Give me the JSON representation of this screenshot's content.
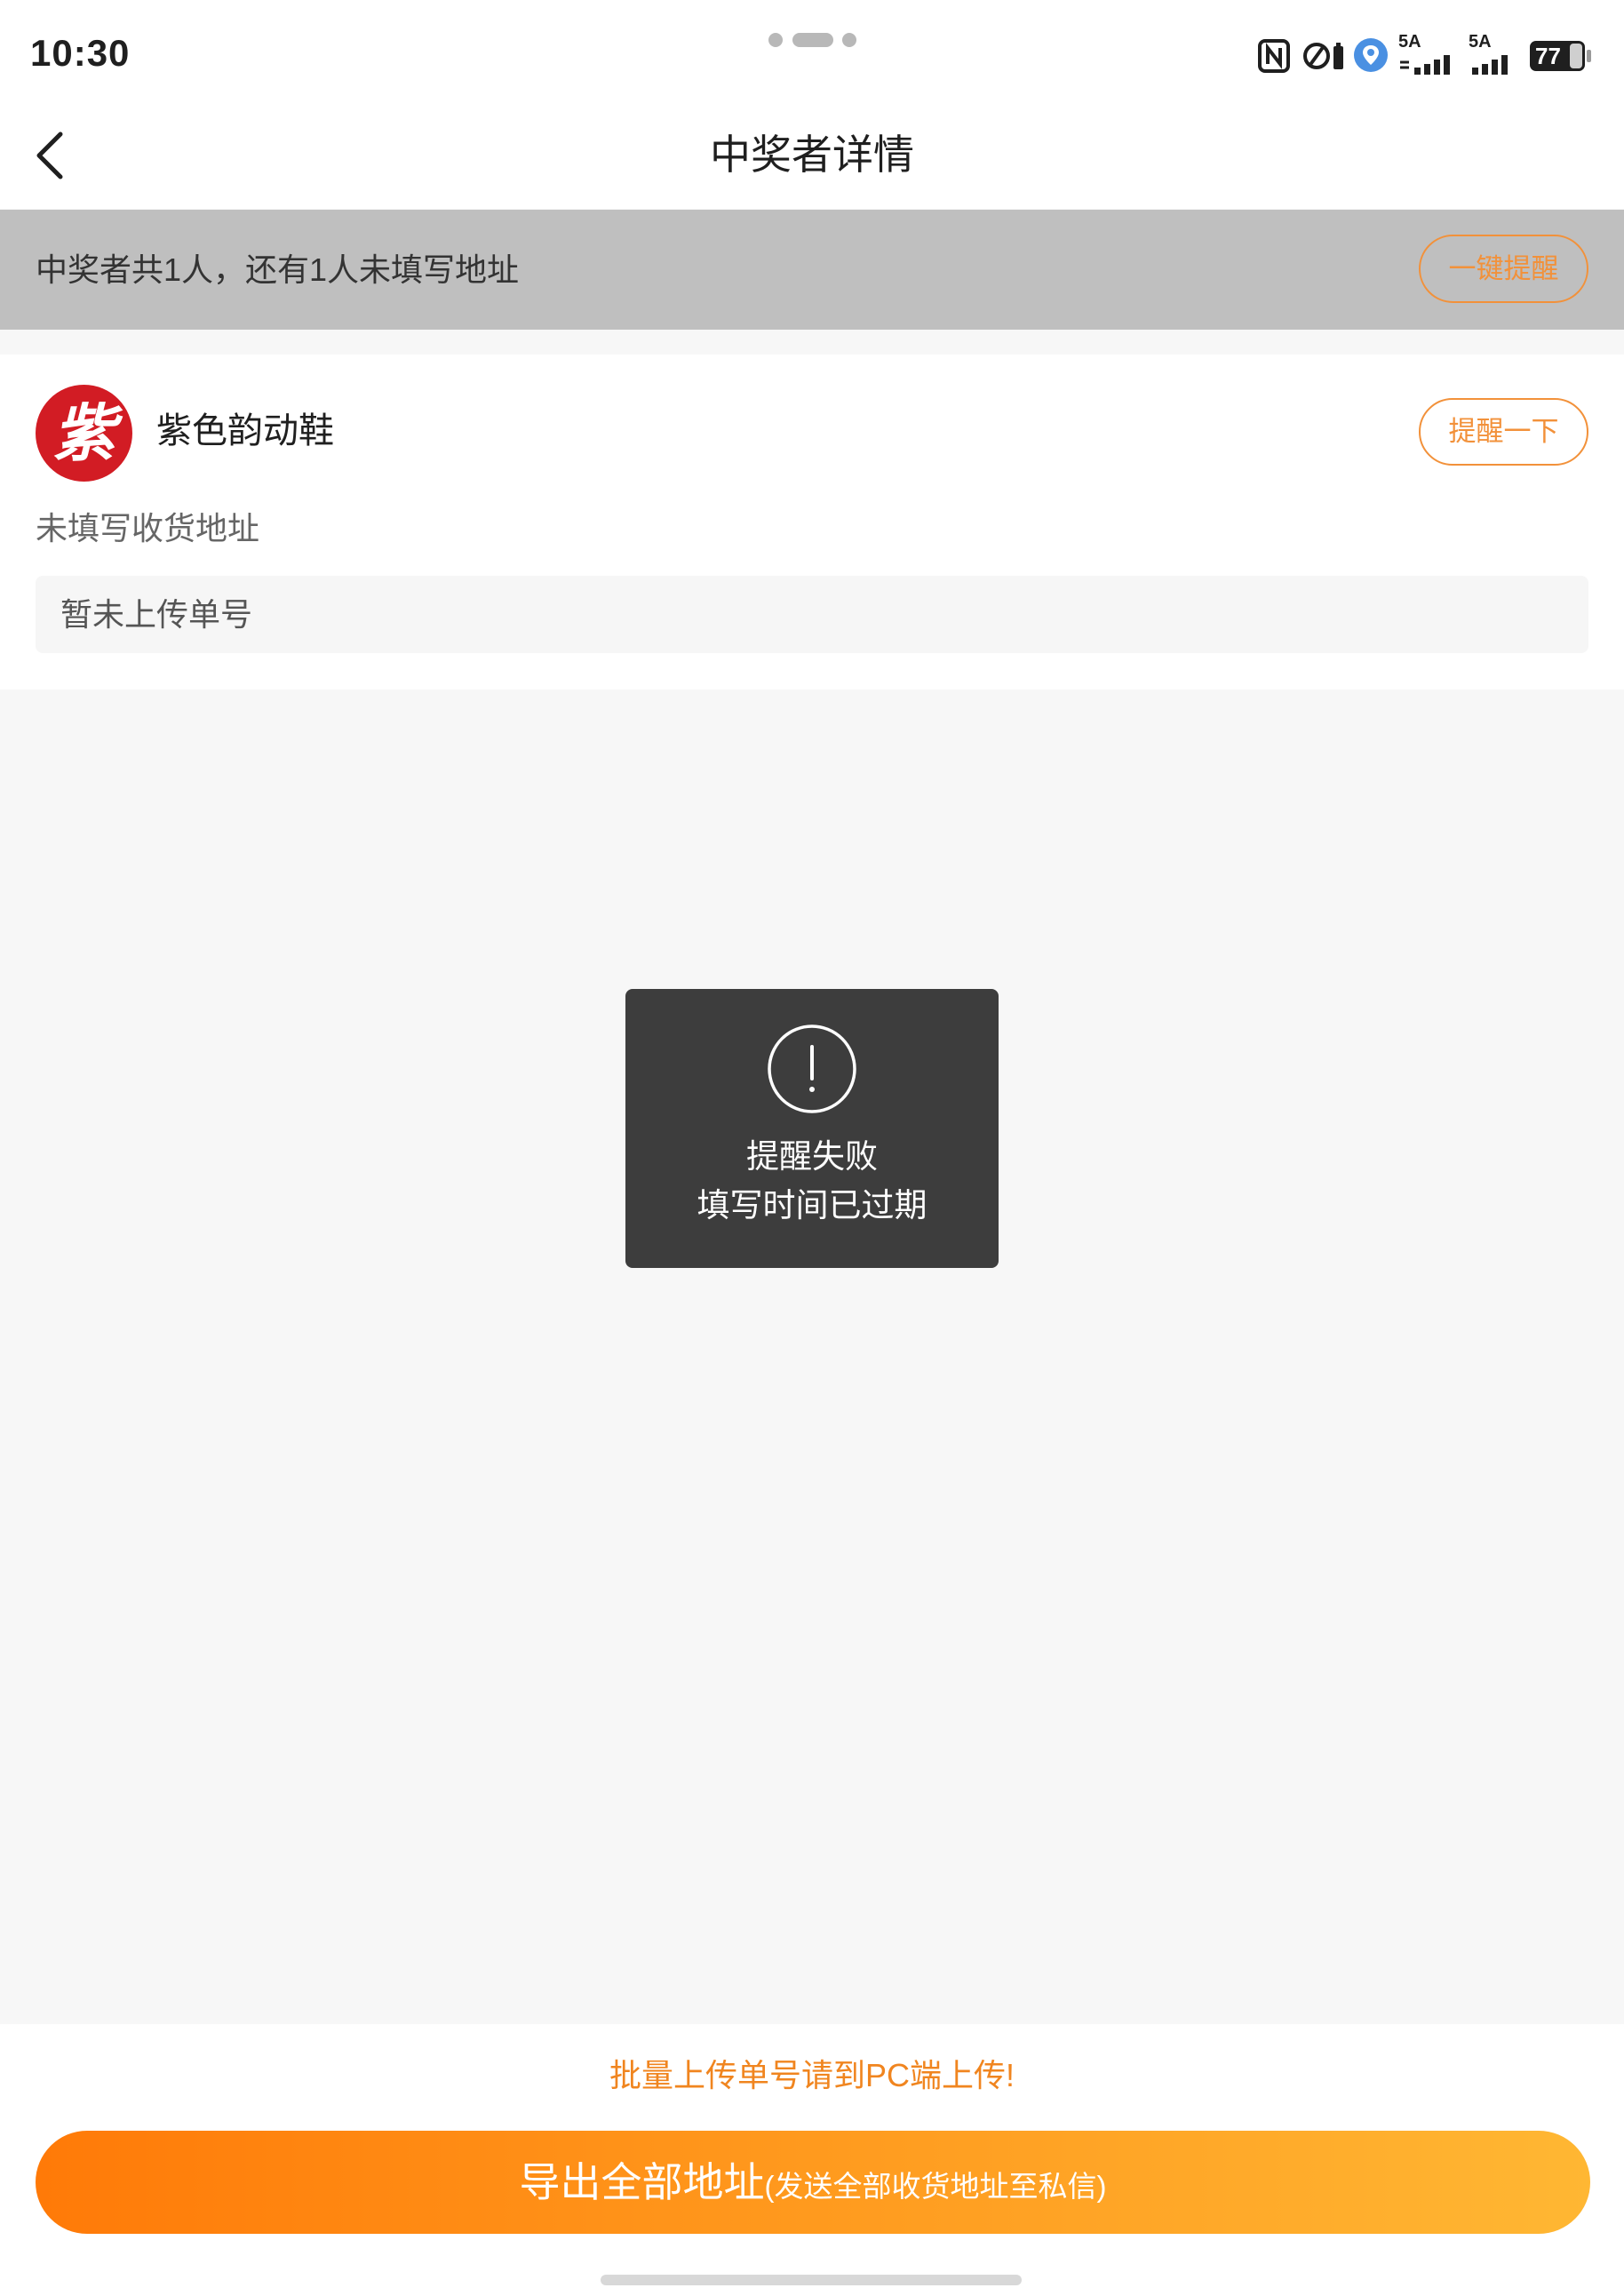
{
  "status_bar": {
    "time": "10:30",
    "signal_1_label": "5A",
    "signal_2_label": "5A",
    "battery_level": "77",
    "icons": [
      "nfc-icon",
      "watch-battery-icon",
      "location-icon",
      "signal-icon",
      "signal-icon",
      "battery-icon"
    ]
  },
  "header": {
    "title": "中奖者详情",
    "back_icon": "chevron-left-icon"
  },
  "banner": {
    "summary": "中奖者共1人，还有1人未填写地址",
    "remind_all_label": "一键提醒"
  },
  "winners": [
    {
      "avatar_char": "紫",
      "name": "紫色韵动鞋",
      "remind_label": "提醒一下",
      "address_status": "未填写收货地址",
      "tracking_placeholder": "暂未上传单号"
    }
  ],
  "toast": {
    "icon": "exclamation-circle-icon",
    "line1": "提醒失败",
    "line2": "填写时间已过期"
  },
  "footer": {
    "hint": "批量上传单号请到PC端上传!",
    "export_label": "导出全部地址",
    "export_sub": "(发送全部收货地址至私信)"
  },
  "colors": {
    "accent": "#f2913a",
    "hint_text": "#f0851f",
    "gradient_start": "#ff7a08",
    "gradient_end": "#ffb733",
    "banner_bg": "#bfbfbf",
    "toast_bg": "#3d3d3d",
    "avatar_bg": "#d21c24",
    "page_bg": "#f7f7f7"
  }
}
